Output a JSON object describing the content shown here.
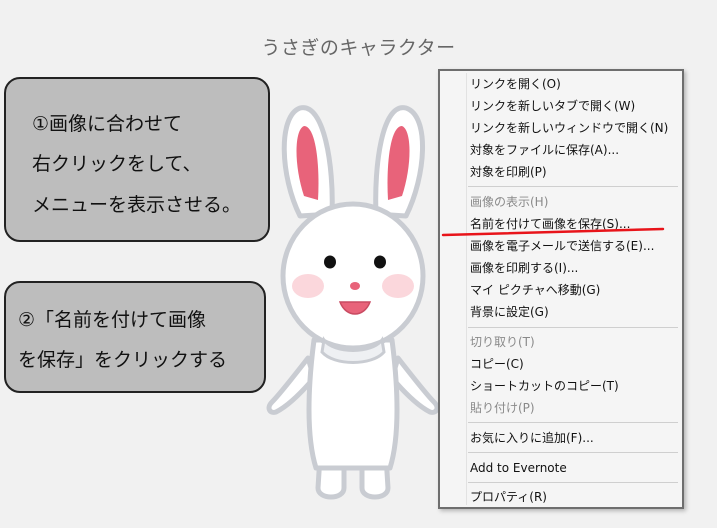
{
  "page": {
    "title": "うさぎのキャラクター"
  },
  "callouts": [
    {
      "lines": [
        "①画像に合わせて",
        "右クリックをして、",
        "メニューを表示させる。"
      ]
    },
    {
      "lines": [
        "②「名前を付けて画像",
        "を保存」をクリックする"
      ]
    }
  ],
  "context_menu": {
    "items": [
      {
        "label": "リンクを開く(O)",
        "enabled": true
      },
      {
        "label": "リンクを新しいタブで開く(W)",
        "enabled": true
      },
      {
        "label": "リンクを新しいウィンドウで開く(N)",
        "enabled": true
      },
      {
        "label": "対象をファイルに保存(A)...",
        "enabled": true
      },
      {
        "label": "対象を印刷(P)",
        "enabled": true
      },
      {
        "label": "画像の表示(H)",
        "enabled": false
      },
      {
        "label": "名前を付けて画像を保存(S)...",
        "enabled": true,
        "highlighted": true
      },
      {
        "label": "画像を電子メールで送信する(E)...",
        "enabled": true
      },
      {
        "label": "画像を印刷する(I)...",
        "enabled": true
      },
      {
        "label": "マイ ピクチャへ移動(G)",
        "enabled": true
      },
      {
        "label": "背景に設定(G)",
        "enabled": true
      },
      {
        "label": "切り取り(T)",
        "enabled": false
      },
      {
        "label": "コピー(C)",
        "enabled": true
      },
      {
        "label": "ショートカットのコピー(T)",
        "enabled": true
      },
      {
        "label": "貼り付け(P)",
        "enabled": false
      },
      {
        "label": "お気に入りに追加(F)...",
        "enabled": true
      },
      {
        "label": "Add to Evernote",
        "enabled": true
      },
      {
        "label": "プロパティ(R)",
        "enabled": true
      }
    ]
  },
  "colors": {
    "callout_bg": "#bdbdbd",
    "highlight_underline": "#e8141a",
    "rabbit_ear_inner": "#e8637a"
  },
  "icons": {
    "illustration": "rabbit-character"
  }
}
